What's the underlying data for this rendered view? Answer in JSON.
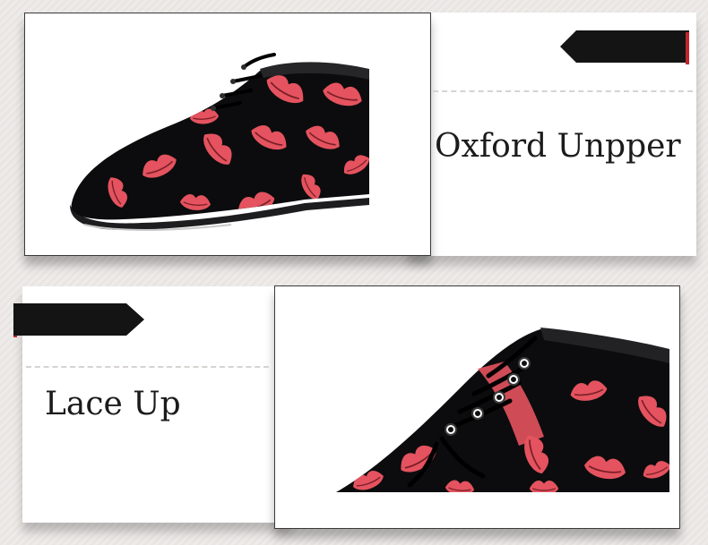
{
  "colors": {
    "panel": "#ffffff",
    "shoe_body": "#0c0c0e",
    "lip_print": "#e4535f",
    "tag": "#141414",
    "tag_accent": "#c0262d"
  },
  "features": [
    {
      "caption": "Oxford Unpper"
    },
    {
      "caption": "Lace Up"
    }
  ]
}
